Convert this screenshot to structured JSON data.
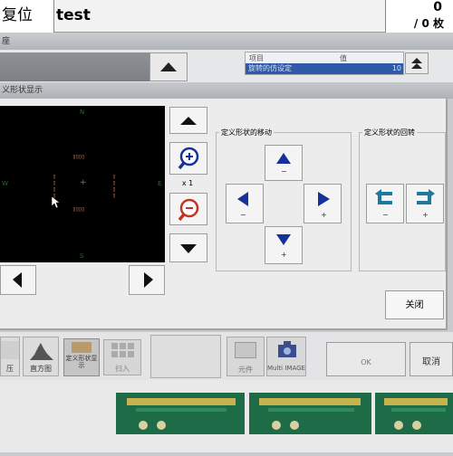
{
  "top_bar": {
    "reset_label": "复位",
    "project_name": "test",
    "count_value": "0",
    "count_total": "/ 0 枚"
  },
  "back_window": {
    "title_fragment": "座",
    "grid": {
      "columns": [
        "项目",
        "值"
      ],
      "selected_row_label": "旋转的仿设定",
      "selected_row_value": "10"
    }
  },
  "dialog": {
    "title": "义形状显示",
    "compass": {
      "north": "N",
      "south": "S",
      "west": "W",
      "east": "E"
    },
    "zoom_label": "x 1",
    "move_group": {
      "label": "定义形状的移动",
      "minus": "−",
      "plus": "+"
    },
    "rotate_group": {
      "label": "定义形状的回转",
      "minus": "−",
      "plus": "+"
    },
    "close_button": "关闭"
  },
  "bottom_toolbar": {
    "items": [
      {
        "label": "压"
      },
      {
        "label": "直方图"
      },
      {
        "label": "定义形状显示"
      },
      {
        "label": "扫入"
      },
      {
        "label": "元件"
      },
      {
        "label": "Multi IMAGE"
      },
      {
        "label": "OK"
      },
      {
        "label": "取消"
      }
    ]
  },
  "colors": {
    "arrow_blue": "#17319a",
    "rotate_teal": "#1e79a0",
    "zoom_red": "#c23520",
    "grid_selected": "#2f5aa8"
  }
}
